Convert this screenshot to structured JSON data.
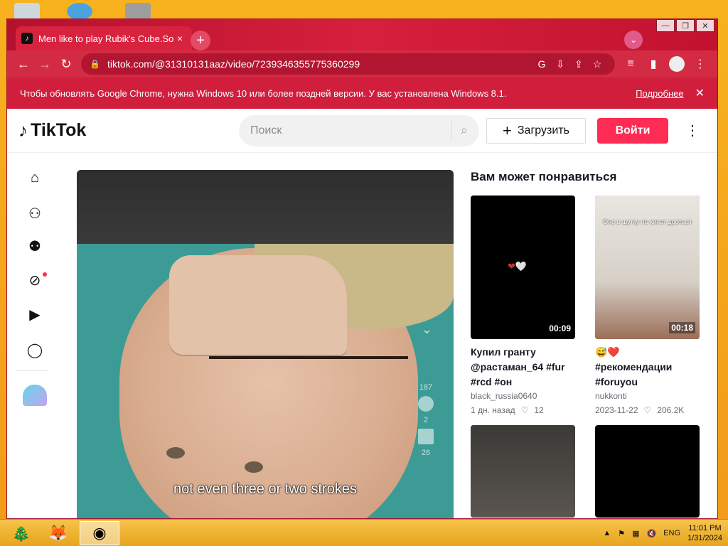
{
  "browser": {
    "tab_title": "Men like to play Rubik's Cube.So",
    "tab_close": "×",
    "new_tab": "+",
    "url": "tiktok.com/@31310131aaz/video/7239346355775360299",
    "window_controls": {
      "minimize": "—",
      "maximize": "❐",
      "close": "✕"
    }
  },
  "infobar": {
    "message": "Чтобы обновлять Google Chrome, нужна Windows 10 или более поздней версии. У вас установлена Windows 8.1.",
    "link": "Подробнее",
    "close": "✕"
  },
  "tiktok": {
    "logo": "TikTok",
    "search_placeholder": "Поиск",
    "upload_label": "Загрузить",
    "login_label": "Войти"
  },
  "video": {
    "caption": "not even three or two strokes",
    "likes": "187",
    "comments": "2",
    "saves": "26"
  },
  "recommendations": {
    "heading": "Вам может понравиться",
    "items": [
      {
        "title": "Купил гранту @растаман_64 #fur #rcd #он",
        "author": "black_russia0640",
        "date": "1 дн. назад",
        "likes": "12",
        "duration": "00:09"
      },
      {
        "title": "😅❤️ #рекомендации #foruyou",
        "author": "nukkonti",
        "date": "2023-11-22",
        "likes": "206.2K",
        "duration": "00:18",
        "overlay_text": "Оно в шутку не кинет дроться"
      }
    ]
  },
  "taskbar": {
    "lang": "ENG",
    "time": "11:01 PM",
    "date": "1/31/2024"
  },
  "colors": {
    "chrome_red": "#d42b45",
    "tiktok_pink": "#fe2c55",
    "taskbar": "#f6c34a"
  }
}
